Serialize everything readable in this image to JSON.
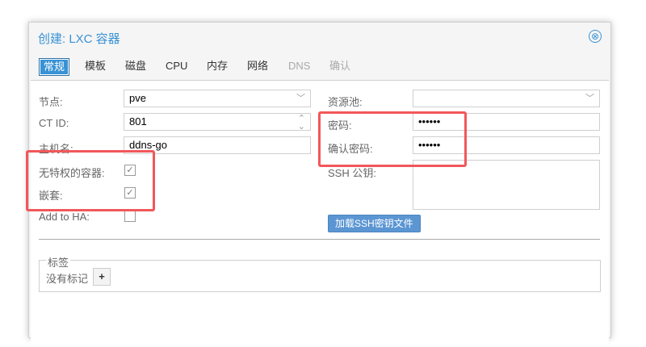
{
  "title": "创建: LXC 容器",
  "tabs": [
    "常规",
    "模板",
    "磁盘",
    "CPU",
    "内存",
    "网络",
    "DNS",
    "确认"
  ],
  "left": {
    "node_label": "节点:",
    "node_value": "pve",
    "ctid_label": "CT ID:",
    "ctid_value": "801",
    "hostname_label": "主机名:",
    "hostname_value": "ddns-go",
    "unpriv_label": "无特权的容器:",
    "nesting_label": "嵌套:",
    "ha_label": "Add to HA:"
  },
  "right": {
    "pool_label": "资源池:",
    "pool_value": "",
    "password_label": "密码:",
    "password_value": "••••••",
    "confirm_label": "确认密码:",
    "confirm_value": "••••••",
    "ssh_label": "SSH 公钥:",
    "load_ssh_button": "加载SSH密钥文件"
  },
  "tags": {
    "legend": "标签",
    "empty": "没有标记",
    "add": "+"
  },
  "icons": {
    "close": "⊗",
    "check": "✓",
    "dropdown": "﹀",
    "spinner": "⌃⌄"
  },
  "colors": {
    "accent": "#3892d4",
    "highlight": "#f2575a"
  }
}
